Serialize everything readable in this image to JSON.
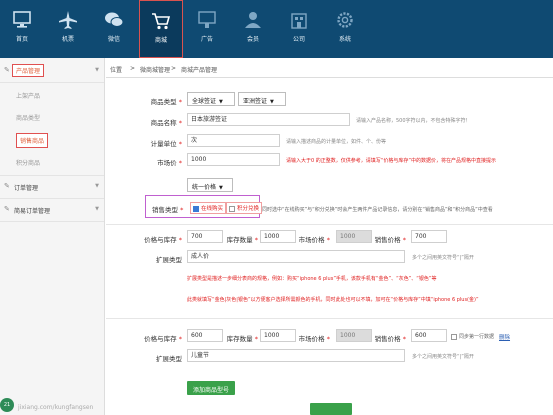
{
  "nav": {
    "items": [
      {
        "label": "首页",
        "icon": "monitor-icon"
      },
      {
        "label": "机票",
        "icon": "airplane-icon"
      },
      {
        "label": "微信",
        "icon": "wechat-icon"
      },
      {
        "label": "商城",
        "icon": "cart-icon"
      },
      {
        "label": "广告",
        "icon": "ad-icon"
      },
      {
        "label": "会员",
        "icon": "members-icon"
      },
      {
        "label": "公司",
        "icon": "company-icon"
      },
      {
        "label": "系统",
        "icon": "gear-icon"
      }
    ],
    "active_label": "商城",
    "colors": {
      "bar": "#0f4a72",
      "active": "#0b3a5c",
      "highlight": "#d9534f"
    }
  },
  "sidebar": {
    "group_product": "产品管理",
    "items": [
      "上架产品",
      "商品类型",
      "销售商品",
      "积分商品"
    ],
    "group_order": "订单管理",
    "group_simple_order": "简易订单管理"
  },
  "breadcrumb": {
    "root": "位置",
    "sep": ">",
    "level1": "微商城管理",
    "level2": "商城产品管理"
  },
  "form": {
    "type_label": "商品类型",
    "type_select_1": "全球签证",
    "type_select_2": "亚洲签证",
    "name_label": "商品名称",
    "name_value": "日本旅游签证",
    "name_hint": "请输入产品名称，500字符以内，不包含特殊字符！",
    "unit_label": "计量单位",
    "unit_value": "次",
    "unit_hint": "请输入描述商品的计量单位，如件、个、份等",
    "market_price_label": "市场价",
    "market_price_value": "1000",
    "market_price_hint": "请输入大于0 的正整数，仅供参考，请填写“价格与库存”中的数据价，将在产品规格中直接提示",
    "unified_price_select": "统一价格",
    "sale_type_label": "销售类型",
    "sale_type_opt1": "在线购买",
    "sale_type_opt2": "积分兑换",
    "sale_type_hint": "同时选中“在线购买”与“积分兑换”时会产生两件产品记录信息，请分别在“销售商品”和“积分商品”中查看"
  },
  "spec1": {
    "price_stock_label": "价格与库存",
    "price": "700",
    "stock_label": "库存数量",
    "stock": "1000",
    "market_label": "市场价格",
    "market": "1000",
    "sale_label": "销售价格",
    "sale": "700",
    "ext_label": "扩展类型",
    "ext_value": "成人价",
    "ext_hint": "多个之间用英文符号“|”隔开",
    "desc_line1": "扩展类型是描述一步细分表商的规格，例如：购买“iphone 6 plus”手机，该款手机有“金色”、“灰色”、“银色”等",
    "desc_line2": "此类就填写“金色|灰色|银色”以方便客户选择所需颜色的手机，同时此处也可以不填，加可在“价格与库存”中填“iphone 6 plus(金)”"
  },
  "spec2": {
    "price_stock_label": "价格与库存",
    "price": "600",
    "stock_label": "库存数量",
    "stock": "1000",
    "market_label": "市场价格",
    "market": "1000",
    "sale_label": "销售价格",
    "sale": "600",
    "sync_label": "同步第一行数据",
    "delete_link": "删除",
    "ext_label": "扩展类型",
    "ext_value": "儿童节",
    "ext_hint": "多个之间用英文符号“|”隔开"
  },
  "actions": {
    "add_spec": "添加商品型号"
  },
  "watermark": {
    "text": "jixiang.com/kungfangsen",
    "logo": "21"
  }
}
